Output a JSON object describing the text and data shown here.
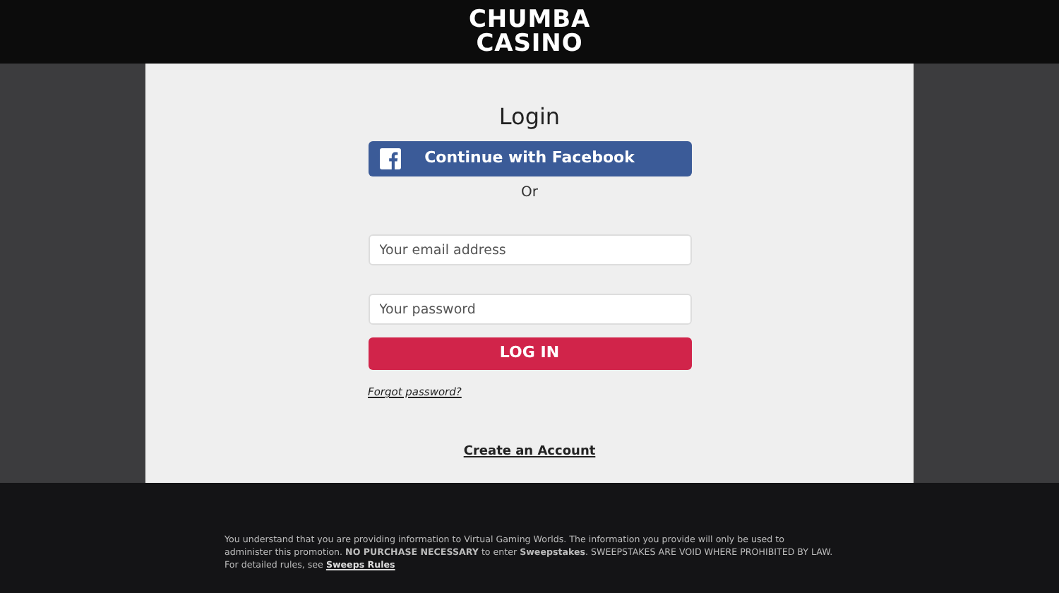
{
  "logo": {
    "line_1": "CHUMBA",
    "line_2": "CASINO"
  },
  "login": {
    "title": "Login",
    "facebook_button": "Continue with Facebook",
    "separator": "Or",
    "email": {
      "placeholder": "Your email address"
    },
    "password": {
      "placeholder": "Your password"
    },
    "login_button": "LOG IN",
    "forgot_link": "Forgot password?",
    "create_link": "Create an Account"
  },
  "footer": {
    "text": "You understand that you are providing information to Virtual Gaming Worlds. The information you provide will only be used to administer this promotion. **NO PURCHASE NECESSARY** to enter **Sweepstakes**. SWEEPSTAKES ARE VOID WHERE PROHIBITED BY LAW. For detailed rules, see",
    "link": "Sweeps Rules"
  }
}
